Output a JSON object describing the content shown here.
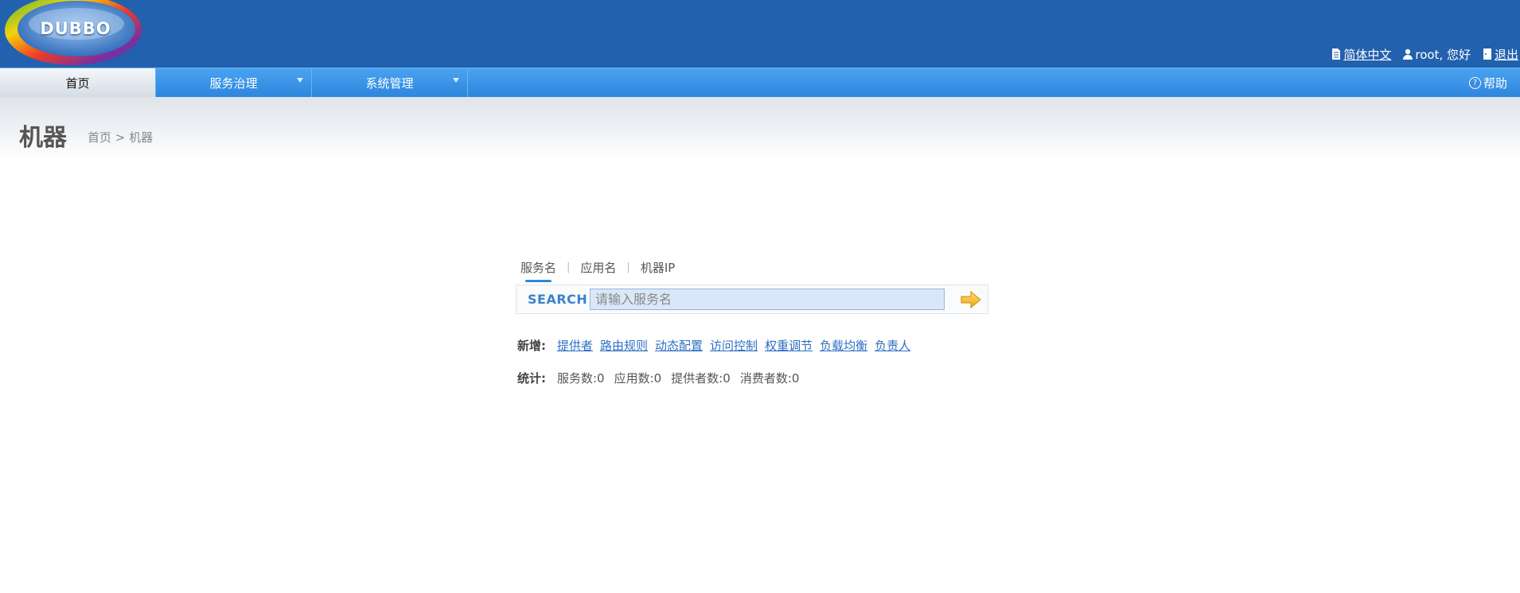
{
  "header": {
    "logo_text": "DUBBO",
    "language_link": "简体中文",
    "greeting": "root, 您好",
    "logout_link": "退出"
  },
  "nav": {
    "tabs": [
      {
        "label": "首页",
        "active": true
      },
      {
        "label": "服务治理",
        "dropdown": true
      },
      {
        "label": "系统管理",
        "dropdown": true
      }
    ],
    "help_label": "帮助"
  },
  "page": {
    "title": "机器",
    "breadcrumb": "首页 > 机器"
  },
  "search": {
    "tabs": [
      "服务名",
      "应用名",
      "机器IP"
    ],
    "active_tab": "服务名",
    "label": "SEARCH",
    "placeholder": "请输入服务名",
    "value": ""
  },
  "add": {
    "label": "新增:",
    "links": [
      "提供者",
      "路由规则",
      "动态配置",
      "访问控制",
      "权重调节",
      "负载均衡",
      "负责人"
    ]
  },
  "stats": {
    "label": "统计:",
    "items": [
      "服务数:0",
      "应用数:0",
      "提供者数:0",
      "消费者数:0"
    ]
  },
  "colors": {
    "header_bg": "#2261ad",
    "nav_bg": "#3a93e6",
    "link": "#2f6fc4",
    "accent": "#2d86dd"
  }
}
